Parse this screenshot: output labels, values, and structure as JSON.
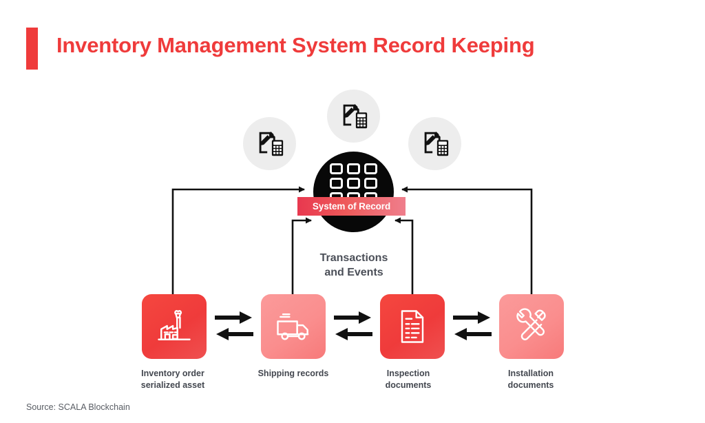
{
  "header": {
    "title": "Inventory Management System Record Keeping",
    "accent_color": "#ef3b3b"
  },
  "hub": {
    "icon": "grid-3x3-icon",
    "banner_label": "System of Record",
    "banner_gradient_from": "#e8384f",
    "banner_gradient_to": "#ef7e8c",
    "circle_color": "#080808"
  },
  "flow_caption": "Transactions\nand Events",
  "flow_caption_line1": "Transactions",
  "flow_caption_line2": "and Events",
  "document_circles": [
    {
      "name": "document-pencil-calculator-icon-left",
      "bg": "#ededed"
    },
    {
      "name": "document-pencil-calculator-icon-center",
      "bg": "#ededed"
    },
    {
      "name": "document-pencil-calculator-icon-right",
      "bg": "#ededed"
    }
  ],
  "nodes": [
    {
      "id": "inventory-order",
      "icon": "factory-icon",
      "label_line1": "Inventory order",
      "label_line2": "serialized asset",
      "color": "#ef3b3b",
      "tone": "strong"
    },
    {
      "id": "shipping-records",
      "icon": "delivery-truck-icon",
      "label_line1": "Shipping records",
      "label_line2": "",
      "color": "#fa8e8e",
      "tone": "soft"
    },
    {
      "id": "inspection-documents",
      "icon": "document-lines-icon",
      "label_line1": "Inspection",
      "label_line2": "documents",
      "color": "#ef3b3b",
      "tone": "strong"
    },
    {
      "id": "installation-documents",
      "icon": "wrench-hammer-icon",
      "label_line1": "Installation",
      "label_line2": "documents",
      "color": "#fa8e8e",
      "tone": "soft"
    }
  ],
  "exchange_arrows": [
    {
      "id": "exchange-1-2",
      "directions": "right-and-left"
    },
    {
      "id": "exchange-2-3",
      "directions": "right-and-left"
    },
    {
      "id": "exchange-3-4",
      "directions": "right-and-left"
    }
  ],
  "connectors": [
    {
      "id": "inventory-order-to-hub",
      "direction": "to-hub"
    },
    {
      "id": "shipping-records-to-hub",
      "direction": "to-hub"
    },
    {
      "id": "inspection-documents-to-hub",
      "direction": "to-hub"
    },
    {
      "id": "installation-documents-to-hub",
      "direction": "to-hub"
    }
  ],
  "footer": {
    "source": "Source: SCALA Blockchain"
  }
}
